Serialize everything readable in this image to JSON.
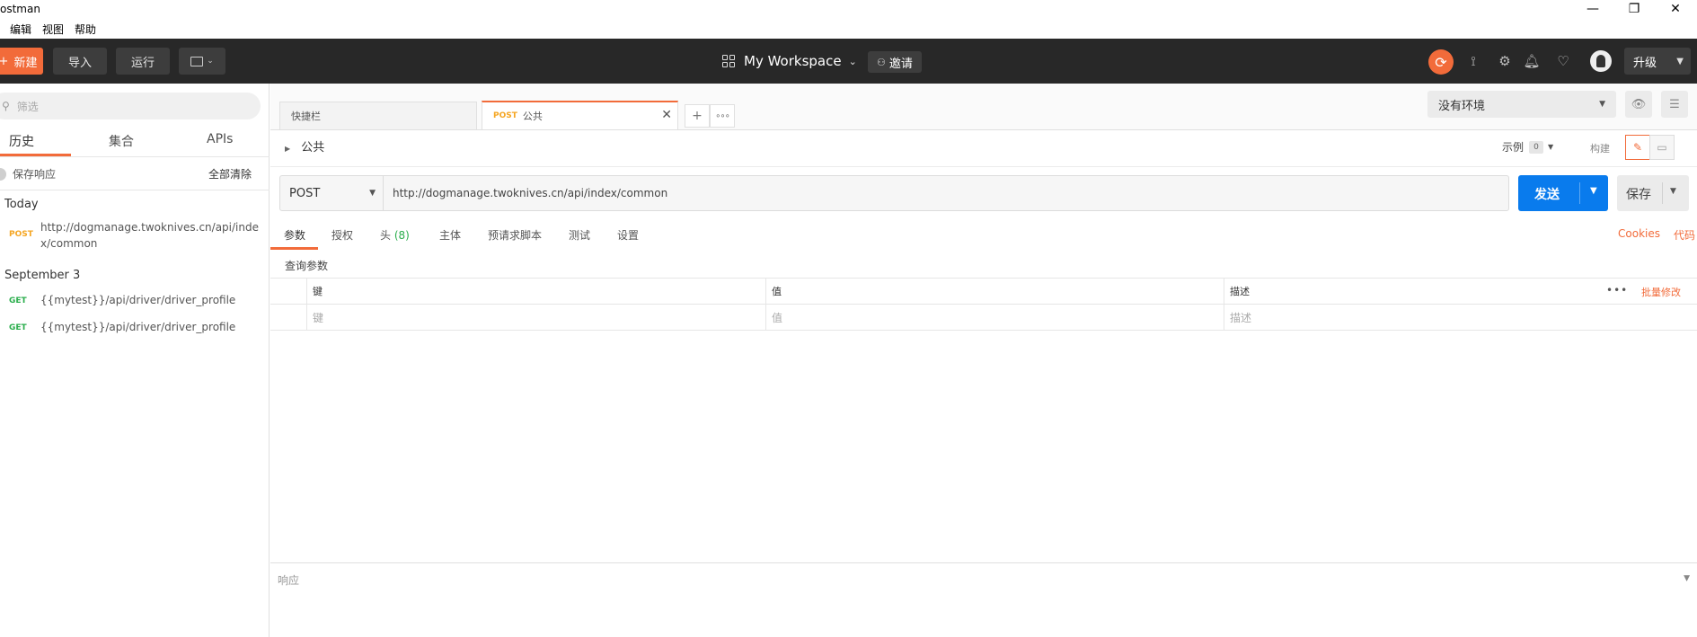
{
  "window": {
    "title": "ostman",
    "controls": {
      "minimize": "—",
      "restore": "❐",
      "close": "✕"
    }
  },
  "menu": [
    "编辑",
    "视图",
    "帮助"
  ],
  "header": {
    "new_label": "新建",
    "import_label": "导入",
    "run_label": "运行",
    "workspace": "My Workspace",
    "invite_label": "邀请",
    "upgrade_label": "升级",
    "accent_color": "#f26b3a"
  },
  "sidebar": {
    "search_placeholder": "筛选",
    "tabs": [
      "历史",
      "集合",
      "APIs"
    ],
    "active_tab": "历史",
    "save_responses": "保存响应",
    "clear_all": "全部清除",
    "groups": [
      {
        "label": "Today",
        "items": [
          {
            "method": "POST",
            "url": "http://dogmanage.twoknives.cn/api/index/common"
          }
        ]
      },
      {
        "label": "September 3",
        "items": [
          {
            "method": "GET",
            "url": "{{mytest}}/api/driver/driver_profile"
          },
          {
            "method": "GET",
            "url": "{{mytest}}/api/driver/driver_profile"
          }
        ]
      }
    ]
  },
  "tabs": {
    "items": [
      {
        "label": "快捷栏"
      },
      {
        "method": "POST",
        "label": "公共",
        "active": true
      }
    ]
  },
  "environment": {
    "selected": "没有环境"
  },
  "request": {
    "name": "公共",
    "examples_label": "示例",
    "examples_count": "0",
    "build_label": "构建",
    "method": "POST",
    "url": "http://dogmanage.twoknives.cn/api/index/common",
    "send_label": "发送",
    "save_label": "保存",
    "sub_tabs": [
      "参数",
      "授权",
      "头",
      "主体",
      "预请求脚本",
      "测试",
      "设置"
    ],
    "headers_count": "(8)",
    "cookies_label": "Cookies",
    "code_label": "代码",
    "query_params_label": "查询参数",
    "params_table": {
      "columns": [
        "键",
        "值",
        "描述"
      ],
      "placeholders": [
        "键",
        "值",
        "描述"
      ],
      "bulk_edit": "批量修改"
    }
  },
  "response": {
    "label": "响应"
  }
}
